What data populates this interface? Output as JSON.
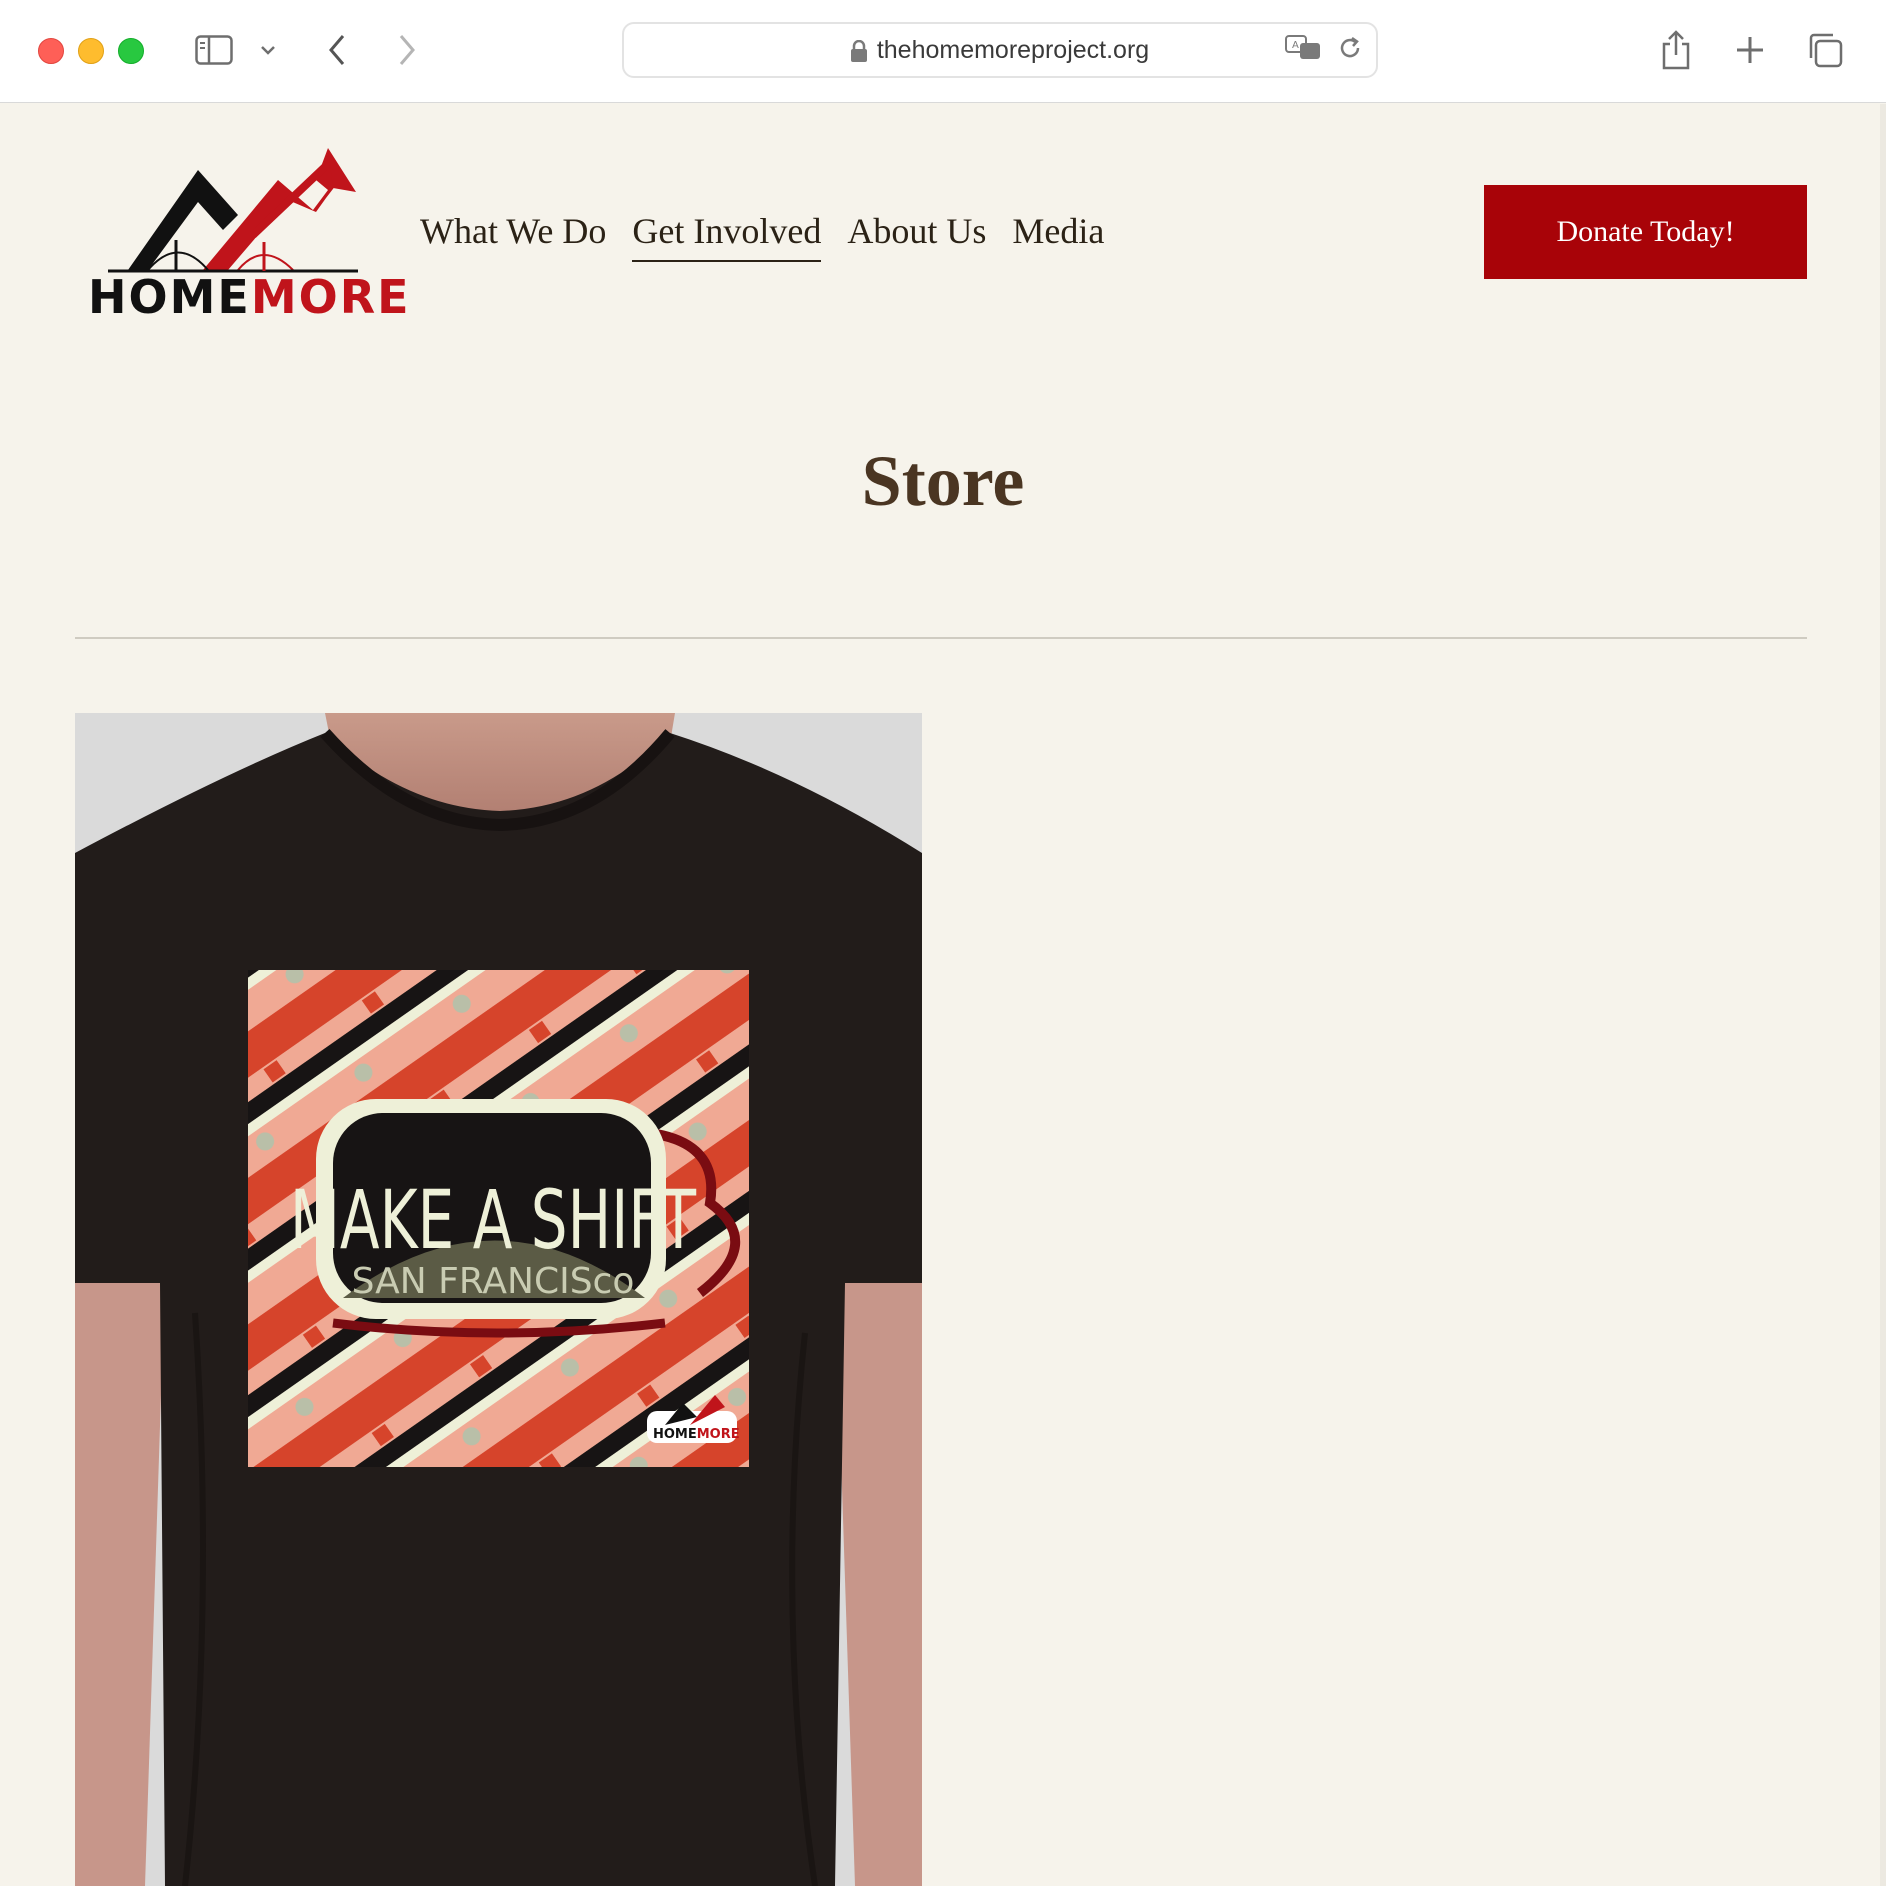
{
  "browser": {
    "url": "thehomemoreproject.org"
  },
  "site": {
    "logo": {
      "home": "HOME",
      "more": "MORE"
    },
    "nav": [
      {
        "label": "What We Do"
      },
      {
        "label": "Get Involved",
        "active": true
      },
      {
        "label": "About Us"
      },
      {
        "label": "Media"
      }
    ],
    "donate_label": "Donate Today!",
    "brand_red": "#a80308"
  },
  "main": {
    "title": "Store",
    "product": {
      "graphic_text": "MAKE A SHIFT",
      "graphic_subtext": "SAN FRANCISco",
      "badge": {
        "home": "HOME",
        "more": "MORE"
      }
    }
  }
}
